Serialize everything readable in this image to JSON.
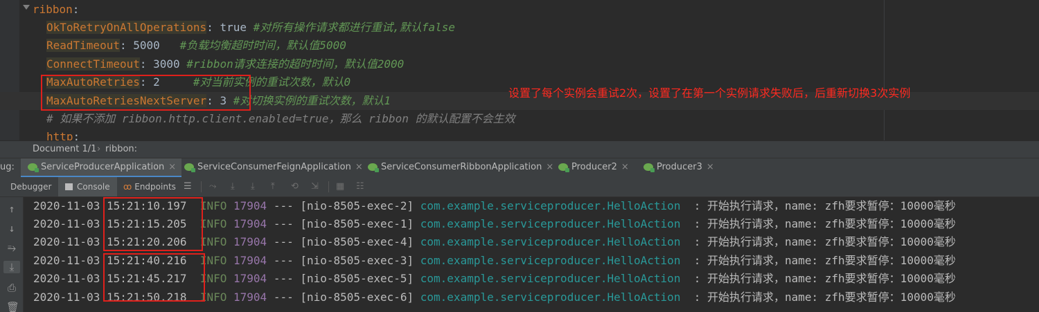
{
  "editor": {
    "lines": [
      {
        "key": "ribbon",
        "value": ":",
        "comment": ""
      },
      {
        "key": "OkToRetryOnAllOperations",
        "value": ": true ",
        "comment": "#对所有操作请求都进行重试,默认false"
      },
      {
        "key": "ReadTimeout",
        "value": ": 5000   ",
        "comment": "#负载均衡超时时间，默认值5000"
      },
      {
        "key": "ConnectTimeout",
        "value": ": 3000 ",
        "comment": "#ribbon请求连接的超时时间，默认值2000"
      },
      {
        "key": "MaxAutoRetries",
        "value": ": 2     ",
        "comment": "#对当前实例的重试次数，默认0"
      },
      {
        "key": "MaxAutoRetriesNextServer",
        "value": ": 3 ",
        "comment": "#对切换实例的重试次数，默认1"
      },
      {
        "key": "",
        "value": "",
        "comment": "# 如果不添加 ribbon.http.client.enabled=true，那么 ribbon 的默认配置不会生效"
      },
      {
        "key": "http",
        "value": ":",
        "comment": ""
      }
    ],
    "annotation": "设置了每个实例会重试2次，设置了在第一个实例请求失败后，后重新切换3次实例"
  },
  "breadcrumb": {
    "doc": "Document 1/1",
    "sep": "›",
    "path": "ribbon:"
  },
  "run_tabs": {
    "prefix": "ug:",
    "tabs": [
      {
        "label": "ServiceProducerApplication",
        "active": true
      },
      {
        "label": "ServiceConsumerFeignApplication",
        "active": false
      },
      {
        "label": "ServiceConsumerRibbonApplication",
        "active": false
      },
      {
        "label": "Producer2",
        "active": false
      },
      {
        "label": "Producer3",
        "active": false
      }
    ],
    "close_glyph": "×"
  },
  "toolbar": {
    "debugger": "Debugger",
    "console": "Console",
    "endpoints": "Endpoints"
  },
  "console": {
    "rows": [
      {
        "date": "2020-11-03",
        "time": "15:21:10.197",
        "level": "INFO",
        "pid": "17904",
        "dash": "---",
        "thread": "[nio-8505-exec-2]",
        "logger": "com.example.serviceproducer.HelloAction",
        "msg": ": 开始执行请求，name: zfh要求暂停：10000毫秒"
      },
      {
        "date": "2020-11-03",
        "time": "15:21:15.205",
        "level": "INFO",
        "pid": "17904",
        "dash": "---",
        "thread": "[nio-8505-exec-1]",
        "logger": "com.example.serviceproducer.HelloAction",
        "msg": ": 开始执行请求，name: zfh要求暂停：10000毫秒"
      },
      {
        "date": "2020-11-03",
        "time": "15:21:20.206",
        "level": "INFO",
        "pid": "17904",
        "dash": "---",
        "thread": "[nio-8505-exec-4]",
        "logger": "com.example.serviceproducer.HelloAction",
        "msg": ": 开始执行请求，name: zfh要求暂停：10000毫秒"
      },
      {
        "date": "2020-11-03",
        "time": "15:21:40.216",
        "level": "INFO",
        "pid": "17904",
        "dash": "---",
        "thread": "[nio-8505-exec-3]",
        "logger": "com.example.serviceproducer.HelloAction",
        "msg": ": 开始执行请求，name: zfh要求暂停：10000毫秒"
      },
      {
        "date": "2020-11-03",
        "time": "15:21:45.217",
        "level": "INFO",
        "pid": "17904",
        "dash": "---",
        "thread": "[nio-8505-exec-5]",
        "logger": "com.example.serviceproducer.HelloAction",
        "msg": ": 开始执行请求，name: zfh要求暂停：10000毫秒"
      },
      {
        "date": "2020-11-03",
        "time": "15:21:50.218",
        "level": "INFO",
        "pid": "17904",
        "dash": "---",
        "thread": "[nio-8505-exec-6]",
        "logger": "com.example.serviceproducer.HelloAction",
        "msg": ": 开始执行请求，name: zfh要求暂停：10000毫秒"
      }
    ]
  },
  "icons": {
    "fold": "fold-arrow-icon",
    "spring": "spring-boot-icon",
    "console": "console-icon",
    "endpoints": "endpoints-icon",
    "menu": "hamburger-icon"
  },
  "colors": {
    "annotation": "#ff2a20",
    "highlight_box": "#e0201b",
    "key": "#cc7832",
    "comment": "#629755",
    "logger": "#299999"
  }
}
